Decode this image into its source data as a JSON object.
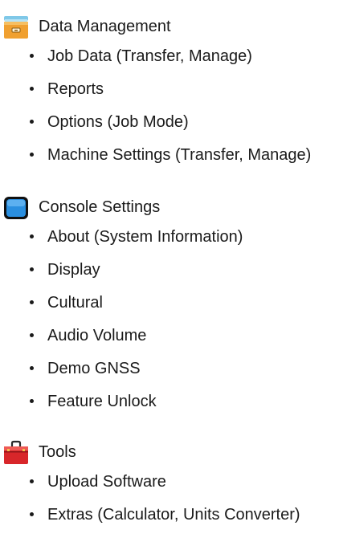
{
  "sections": [
    {
      "title": "Data Management",
      "icon": "file-drawer-icon",
      "items": [
        "Job Data (Transfer, Manage)",
        "Reports",
        "Options (Job Mode)",
        "Machine Settings (Transfer, Manage)"
      ]
    },
    {
      "title": "Console Settings",
      "icon": "console-screen-icon",
      "items": [
        "About (System Information)",
        "Display",
        "Cultural",
        "Audio Volume",
        "Demo GNSS",
        "Feature Unlock"
      ]
    },
    {
      "title": "Tools",
      "icon": "toolbox-icon",
      "items": [
        "Upload Software",
        "Extras (Calculator, Units Converter)"
      ]
    }
  ],
  "colors": {
    "drawer_top": "#7fc8e8",
    "drawer_body": "#f0a030",
    "console_blue": "#2a8fe0",
    "console_frame": "#101010",
    "toolbox_red": "#d8262a"
  }
}
